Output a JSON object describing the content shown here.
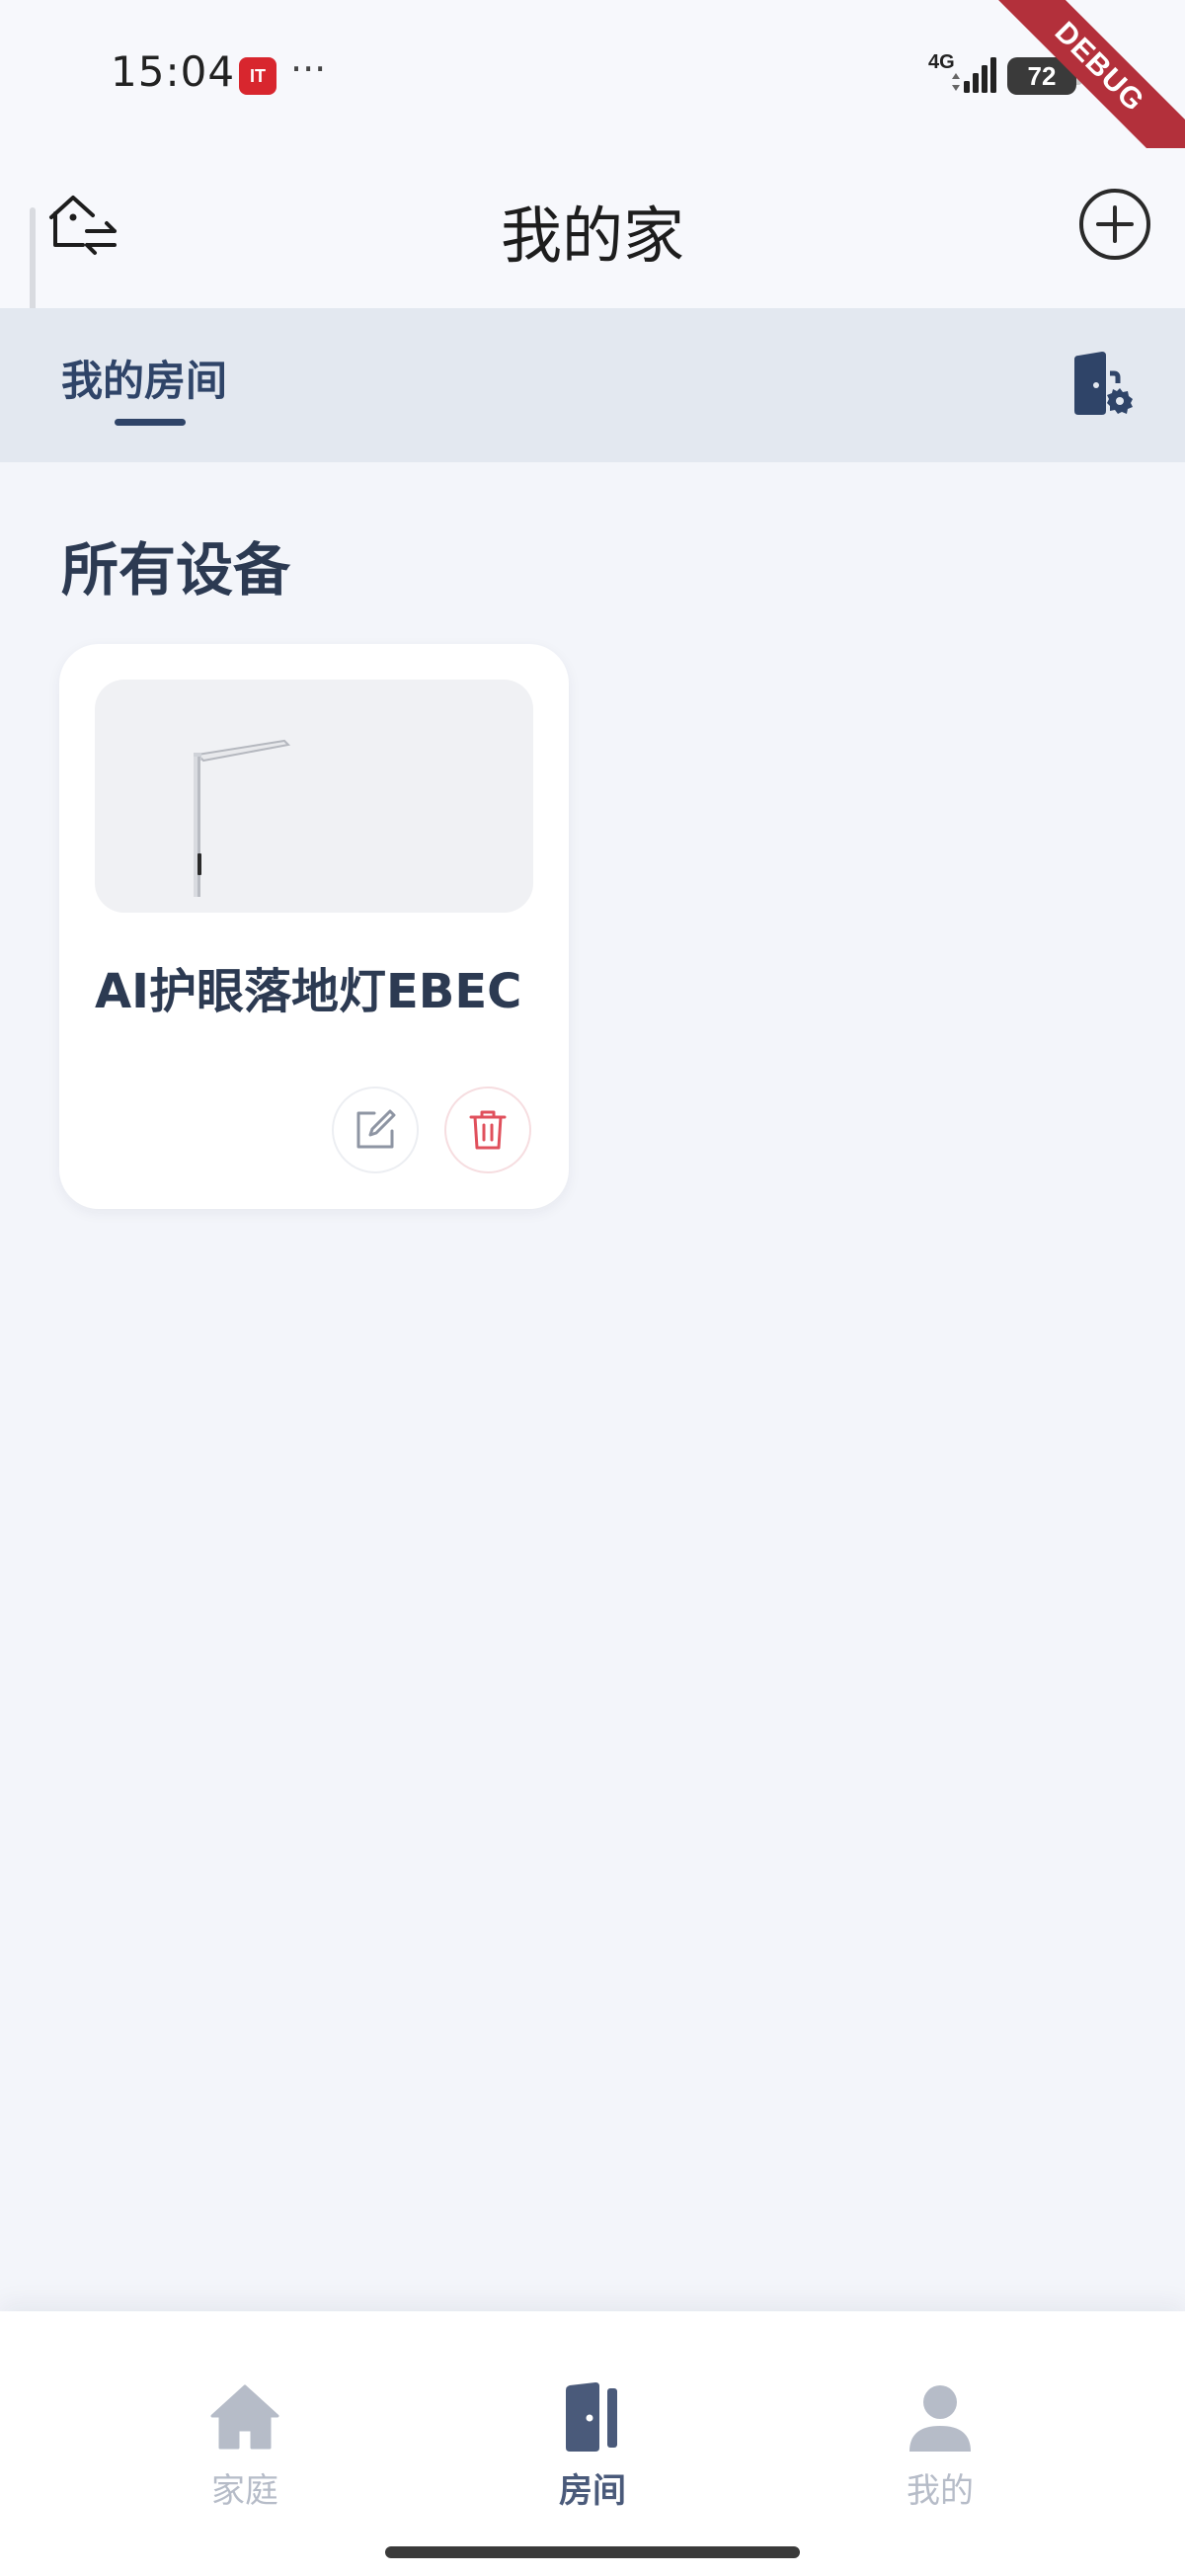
{
  "status_bar": {
    "time": "15:04",
    "notification_badge": "IT",
    "more_indicator": "···",
    "network": "4G",
    "battery": "72",
    "debug_banner": "DEBUG"
  },
  "header": {
    "title": "我的家",
    "left_icon": "switch-home-icon",
    "right_icon": "add-circle-icon"
  },
  "room_tabs": {
    "active_tab": "我的房间",
    "settings_icon": "room-settings-icon"
  },
  "section": {
    "title": "所有设备"
  },
  "devices": [
    {
      "name": "AI护眼落地灯EBEC",
      "image_icon": "floor-lamp-image",
      "actions": [
        "edit-icon",
        "delete-icon"
      ]
    }
  ],
  "bottom_nav": {
    "items": [
      {
        "label": "家庭",
        "icon": "home-icon",
        "active": false
      },
      {
        "label": "房间",
        "icon": "door-icon",
        "active": true
      },
      {
        "label": "我的",
        "icon": "person-icon",
        "active": false
      }
    ]
  },
  "colors": {
    "primary": "#2f4468",
    "background": "#f3f5fa",
    "tab_bar": "#e3e8f0",
    "delete_accent": "#e0505c",
    "debug_ribbon": "#b3303b"
  }
}
